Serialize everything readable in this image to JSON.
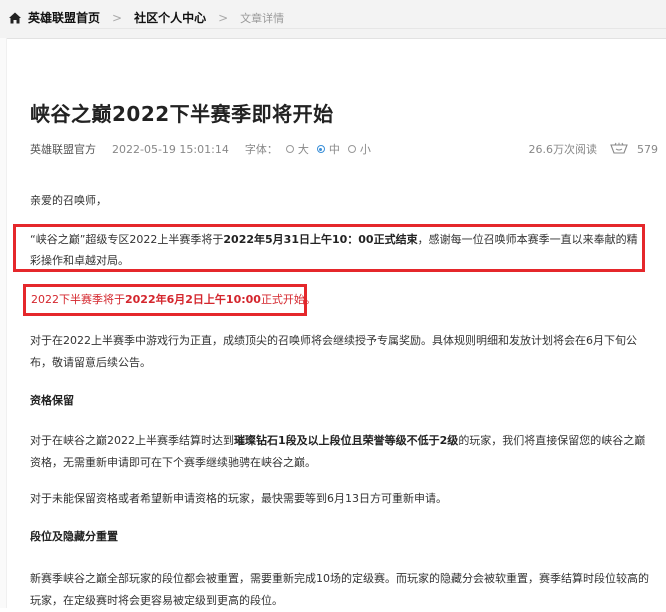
{
  "breadcrumb": {
    "home": "英雄联盟首页",
    "community": "社区个人中心",
    "current": "文章详情"
  },
  "article": {
    "title": "峡谷之巅2022下半赛季即将开始",
    "author": "英雄联盟官方",
    "date": "2022-05-19 15:01:14",
    "font_label": "字体：",
    "font_options": [
      "大",
      "中",
      "小"
    ],
    "font_selected": "中",
    "views": "26.6万次阅读",
    "likes": "579"
  },
  "content": {
    "greeting": "亲爱的召唤师，",
    "box1_a": "“峡谷之巅”超级专区2022上半赛季将于",
    "box1_b": "2022年5月31日上午10：00正式结束",
    "box1_c": "，感谢每一位召唤师本赛季一直以来奉献的精彩操作和卓越对局。",
    "box2_a": "2022下半赛季将于",
    "box2_b": "2022年6月2日上午10:00",
    "box2_c": "正式开始。",
    "para_a": "对于在2022上半赛季中游戏行为正直，成绩顶尖的召唤师将会继续授予专属奖励。具体规则明细和发放计划将会在6月下旬公布，敬请留意后续公告。",
    "heading1": "资格保留",
    "para_b1": "对于在峡谷之巅2022上半赛季结算时达到",
    "para_b2": "璀璨钻石1段及以上段位且荣誉等级不低于2级",
    "para_b3": "的玩家，我们将直接保留您的峡谷之巅资格，无需重新申请即可在下个赛季继续驰骋在峡谷之巅。",
    "para_c": "对于未能保留资格或者希望新申请资格的玩家，最快需要等到6月13日方可重新申请。",
    "heading2": "段位及隐藏分重置",
    "para_d": "新赛季峡谷之巅全部玩家的段位都会被重置，需要重新完成10场的定级赛。而玩家的隐藏分会被软重置，赛季结算时段位较高的玩家，在定级赛时将会更容易被定级到更高的段位。"
  },
  "colors": {
    "highlight_border": "#e5272b",
    "highlight_text": "#d4262d",
    "radio_accent": "#3a8fd8"
  },
  "icons": [
    "home-icon",
    "chevron-right-icon",
    "like-icon"
  ]
}
